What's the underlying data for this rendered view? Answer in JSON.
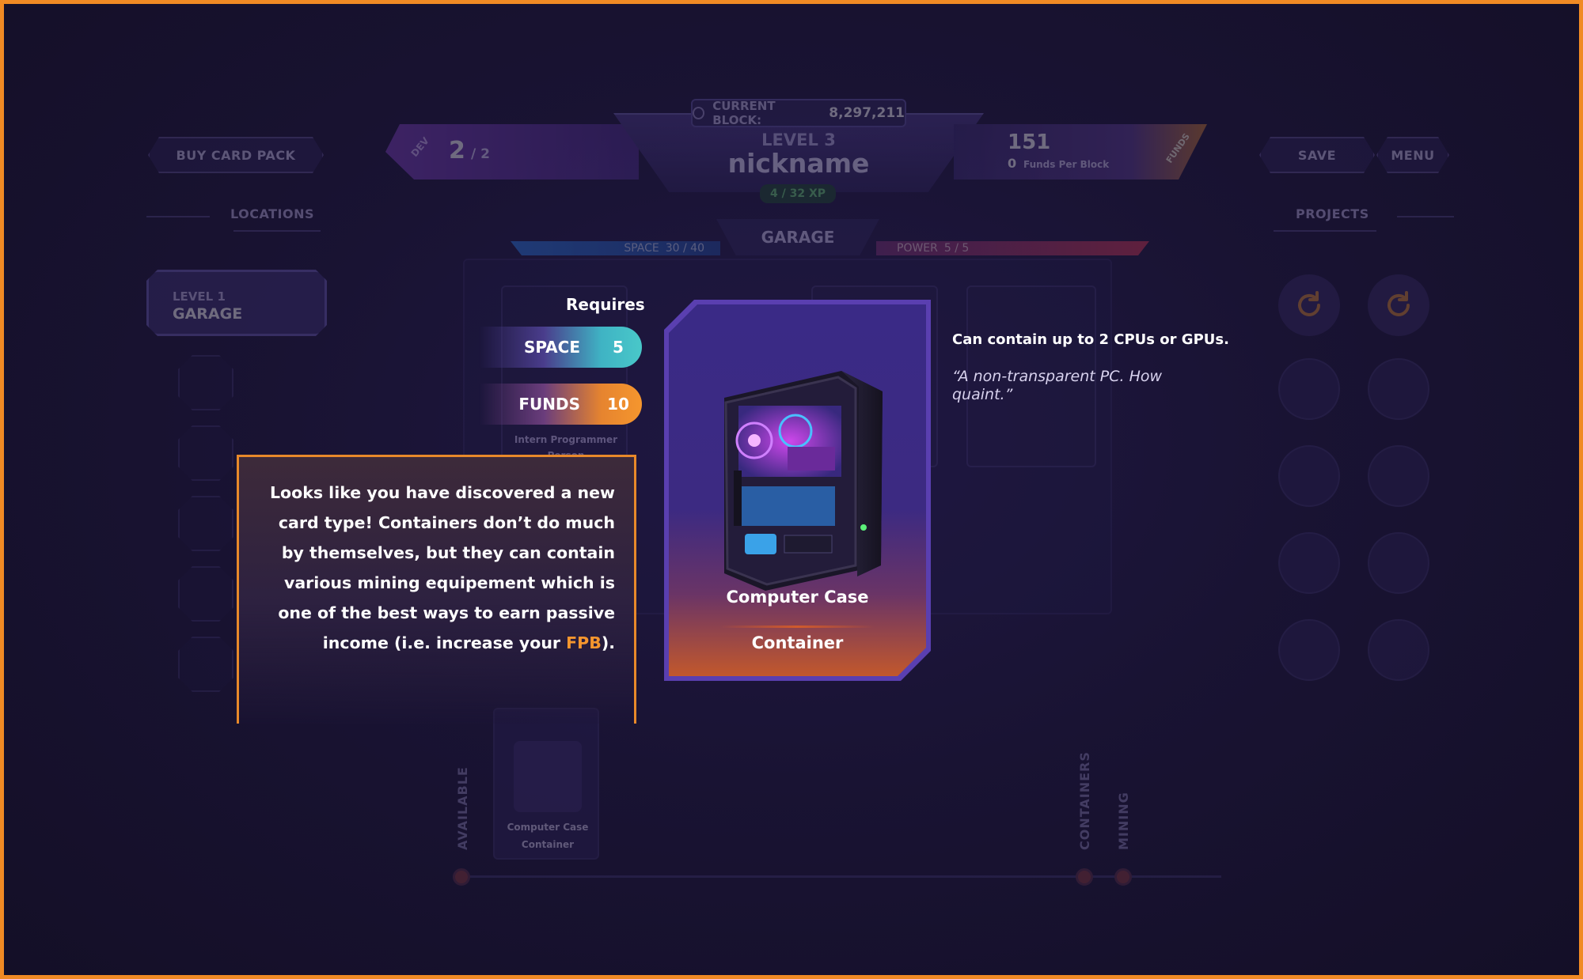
{
  "hud": {
    "buy_card_pack": "BUY CARD PACK",
    "save": "SAVE",
    "menu": "MENU",
    "current_block_label": "CURRENT BLOCK:",
    "current_block_value": "8,297,211",
    "dev_label": "DEV",
    "dev_count": "2",
    "dev_total": "/ 2",
    "level": "LEVEL 3",
    "nickname": "nickname",
    "xp": "4 / 32 XP",
    "funds_value": "151",
    "fpb_value": "0",
    "fpb_label": "Funds Per Block",
    "funds_tag": "FUNDS"
  },
  "locations": {
    "title": "LOCATIONS",
    "selected_level": "LEVEL 1",
    "selected_name": "GARAGE"
  },
  "projects": {
    "title": "PROJECTS"
  },
  "garage": {
    "title": "GARAGE",
    "space_label": "SPACE",
    "space_value": "30 / 40",
    "power_label": "POWER",
    "power_value": "5 / 5"
  },
  "background_card": {
    "line1": "Intern Programmer",
    "line2": "Person"
  },
  "card": {
    "requires": "Requires",
    "space_label": "SPACE",
    "space_value": "5",
    "funds_label": "FUNDS",
    "funds_value": "10",
    "name": "Computer Case",
    "type": "Container",
    "description": "Can contain up to 2 CPUs or GPUs.",
    "quote": "“A non-transparent PC. How quaint.”"
  },
  "tooltip": {
    "text_before": "Looks like you have discovered a new card type! Containers don’t do much by themselves, but they can contain various mining equipement which is one of the best ways to earn passive income (i.e. increase your ",
    "highlight": "FPB",
    "text_after": ")."
  },
  "bottom": {
    "available": "AVAILABLE",
    "containers": "CONTAINERS",
    "mining": "MINING",
    "hand_card_name": "Computer Case",
    "hand_card_type": "Container"
  },
  "colors": {
    "accent_orange": "#f08a24",
    "space_teal": "#3fc0c8",
    "funds_orange": "#f5962e",
    "card_purple": "#3a2a86"
  }
}
